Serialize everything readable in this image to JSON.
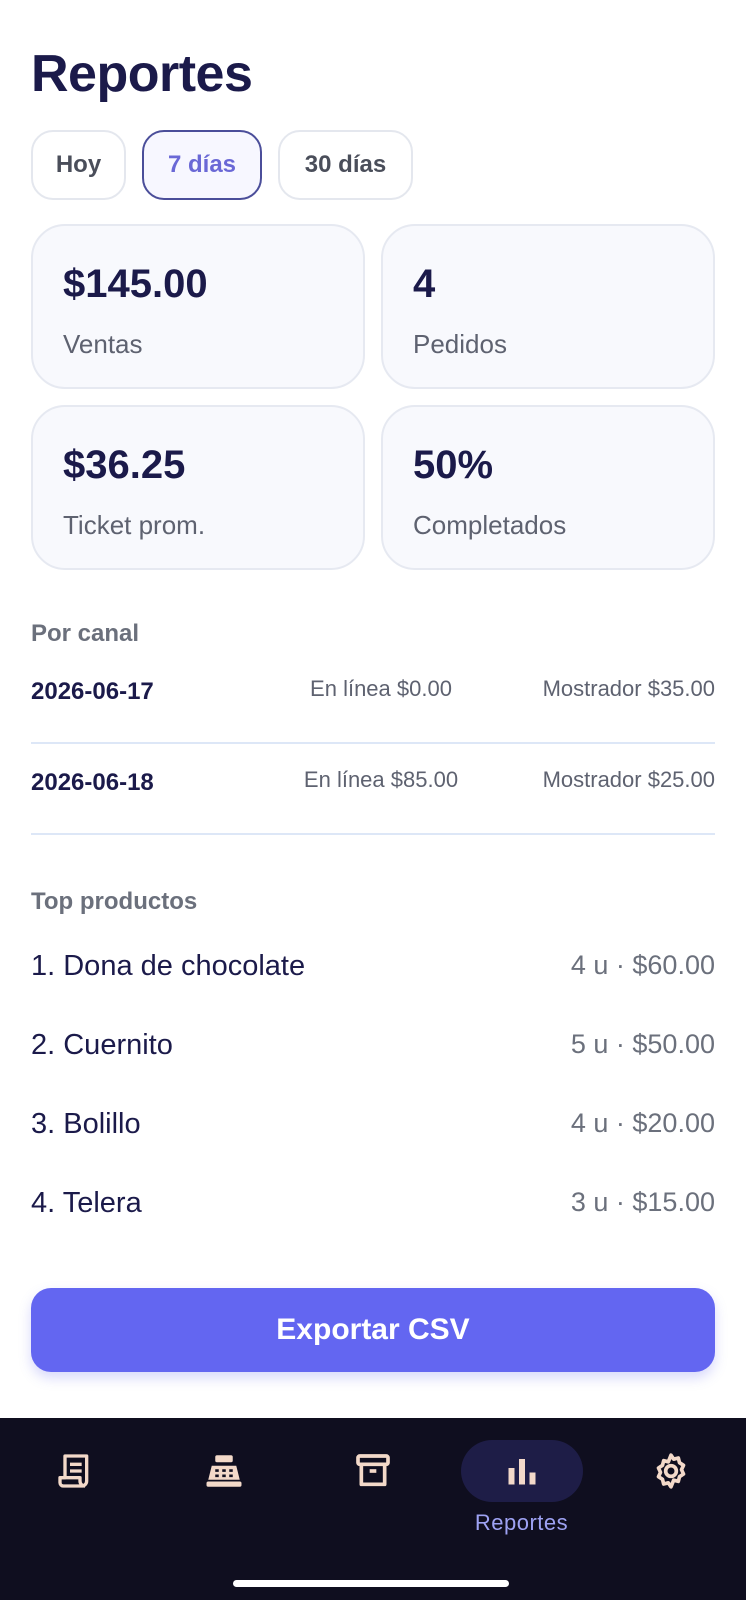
{
  "header": {
    "title": "Reportes"
  },
  "range_tabs": [
    {
      "label": "Hoy",
      "active": false
    },
    {
      "label": "7 días",
      "active": true
    },
    {
      "label": "30 días",
      "active": false
    }
  ],
  "stats": [
    {
      "value": "$145.00",
      "label": "Ventas"
    },
    {
      "value": "4",
      "label": "Pedidos"
    },
    {
      "value": "$36.25",
      "label": "Ticket prom."
    },
    {
      "value": "50%",
      "label": "Completados"
    }
  ],
  "by_channel": {
    "title": "Por canal",
    "rows": [
      {
        "date": "2026-06-17",
        "online": "En línea $0.00",
        "counter": "Mostrador $35.00"
      },
      {
        "date": "2026-06-18",
        "online": "En línea $85.00",
        "counter": "Mostrador $25.00"
      }
    ]
  },
  "top_products": {
    "title": "Top productos",
    "items": [
      {
        "name": "1. Dona de chocolate",
        "stats": "4 u · $60.00"
      },
      {
        "name": "2. Cuernito",
        "stats": "5 u · $50.00"
      },
      {
        "name": "3. Bolillo",
        "stats": "4 u · $20.00"
      },
      {
        "name": "4. Telera",
        "stats": "3 u · $15.00"
      }
    ]
  },
  "export": {
    "label": "Exportar CSV"
  },
  "nav": {
    "items": [
      {
        "icon": "receipt-icon",
        "label": ""
      },
      {
        "icon": "cash-register-icon",
        "label": ""
      },
      {
        "icon": "archive-box-icon",
        "label": ""
      },
      {
        "icon": "bar-chart-icon",
        "label": "Reportes",
        "active": true
      },
      {
        "icon": "gear-icon",
        "label": ""
      }
    ]
  },
  "colors": {
    "accent": "#6366f1",
    "title": "#1b1a4a",
    "nav_background": "#0f0e1f",
    "nav_icon": "#f3d9c9",
    "nav_active_label": "#9ea2f3"
  }
}
